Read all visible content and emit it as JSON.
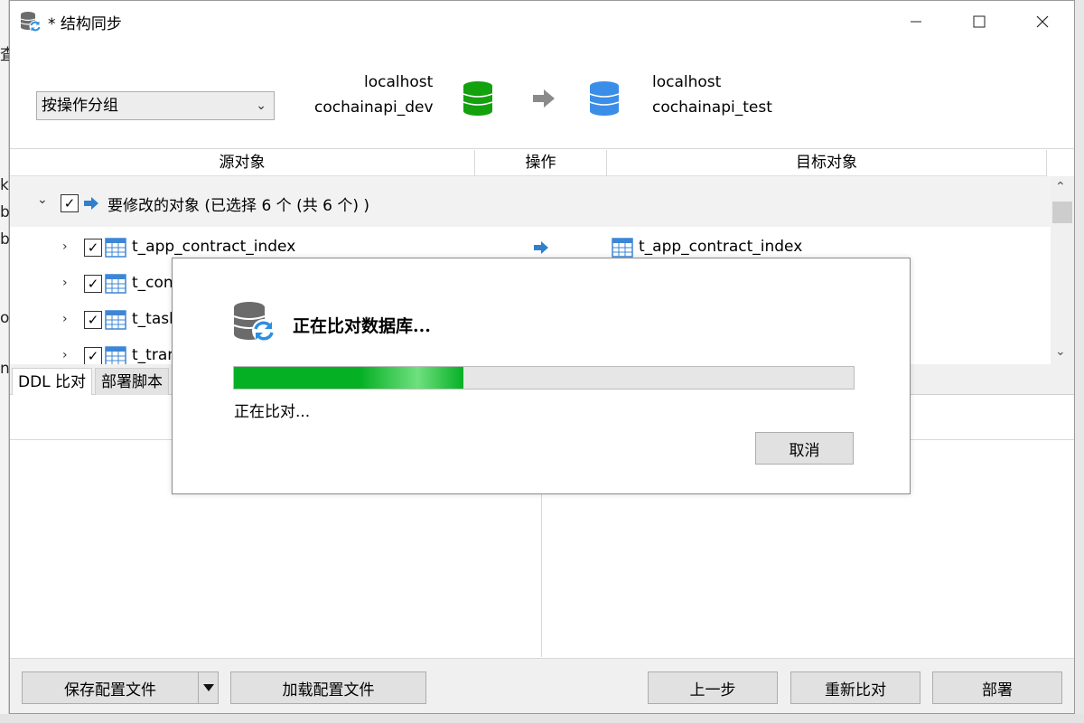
{
  "window": {
    "title": "* 结构同步",
    "min_glyph": "—",
    "max_glyph": "☐",
    "close_glyph": "✕"
  },
  "background_fragments": [
    "査",
    "k",
    "bi",
    "bi",
    "o",
    "n"
  ],
  "header": {
    "group_select": {
      "value": "按操作分组"
    },
    "source": {
      "host": "localhost",
      "database": "cochainapi_dev",
      "icon_color": "#13a10e"
    },
    "target": {
      "host": "localhost",
      "database": "cochainapi_test",
      "icon_color": "#3b8ee8"
    }
  },
  "grid": {
    "columns": [
      "源对象",
      "操作",
      "目标对象"
    ],
    "group": {
      "label": "要修改的对象 (已选择 6 个 (共 6 个) )",
      "checked": true
    },
    "rows": [
      {
        "source": "t_app_contract_index",
        "target": "t_app_contract_index",
        "checked": true
      },
      {
        "source": "t_con",
        "target": "",
        "checked": true
      },
      {
        "source": "t_task",
        "target": "",
        "checked": true
      },
      {
        "source": "t_tran",
        "target": "",
        "checked": true
      }
    ]
  },
  "tabs": [
    "DDL 比对",
    "部署脚本"
  ],
  "footer": {
    "save_config": "保存配置文件",
    "load_config": "加载配置文件",
    "prev": "上一步",
    "recompare": "重新比对",
    "deploy": "部署"
  },
  "modal": {
    "heading": "正在比对数据库...",
    "status": "正在比对...",
    "cancel": "取消",
    "progress_fraction": 0.37,
    "progress_color": "#06b025"
  }
}
